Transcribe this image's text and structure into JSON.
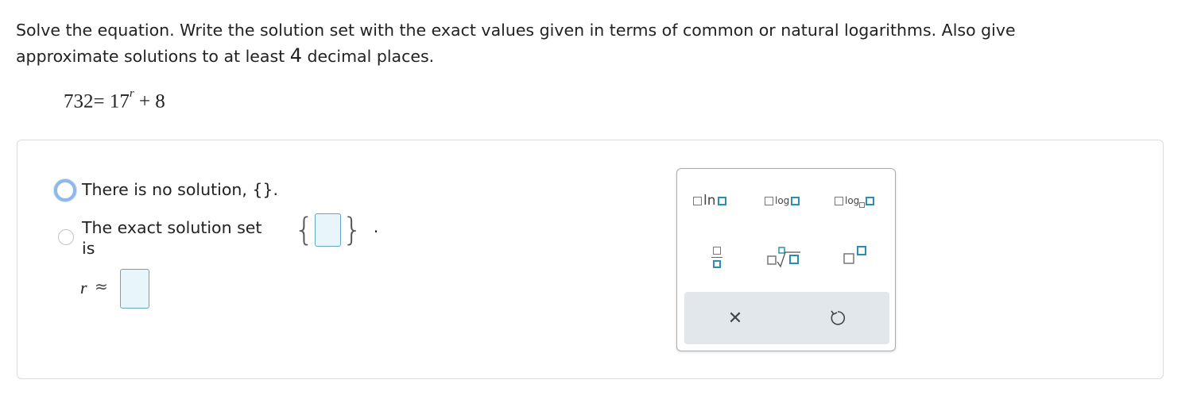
{
  "prompt": {
    "line1": "Solve the equation. Write the solution set with the exact values given in terms of common or natural logarithms. Also give",
    "line2_a": "approximate solutions to at least ",
    "line2_num": "4",
    "line2_b": " decimal places."
  },
  "equation": {
    "lhs": "732",
    "eq": "=",
    "base": "17",
    "exponent": "r",
    "plus_rest": "+ 8"
  },
  "options": {
    "no_solution_label": "There is no solution, {}.",
    "exact_set_label_line1": "The exact solution set",
    "exact_set_label_line2": "is",
    "brace_open": "{",
    "brace_close": "}",
    "period": "."
  },
  "approx": {
    "variable": "r",
    "symbol": "≈"
  },
  "keypad": {
    "ln_label": "ln",
    "log_label": "log",
    "logb_label": "log",
    "clear_symbol": "✕",
    "undo_symbol": "↺"
  },
  "colors": {
    "accent_teal": "#2b8fb3",
    "input_fill": "#e8f6fb",
    "focus_ring": "#8db8e8"
  }
}
